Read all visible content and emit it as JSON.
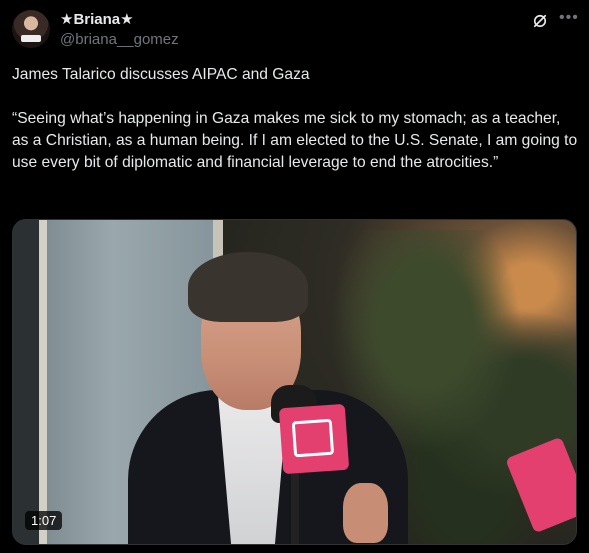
{
  "author": {
    "display_name": "★Briana★",
    "handle": "@briana__gomez"
  },
  "post": {
    "line1": "James Talarico discusses AIPAC and Gaza",
    "quote": "“Seeing what’s happening in Gaza makes me sick to my stomach; as a teacher, as a Christian, as a human being. If I am elected to the U.S. Senate, I am going to use every bit of diplomatic and financial leverage to end the atrocities.”"
  },
  "media": {
    "duration": "1:07"
  },
  "icons": {
    "grok": "grok-icon",
    "more": "more-icon"
  },
  "colors": {
    "background": "#000000",
    "text": "#e7e9ea",
    "muted": "#71767b"
  }
}
